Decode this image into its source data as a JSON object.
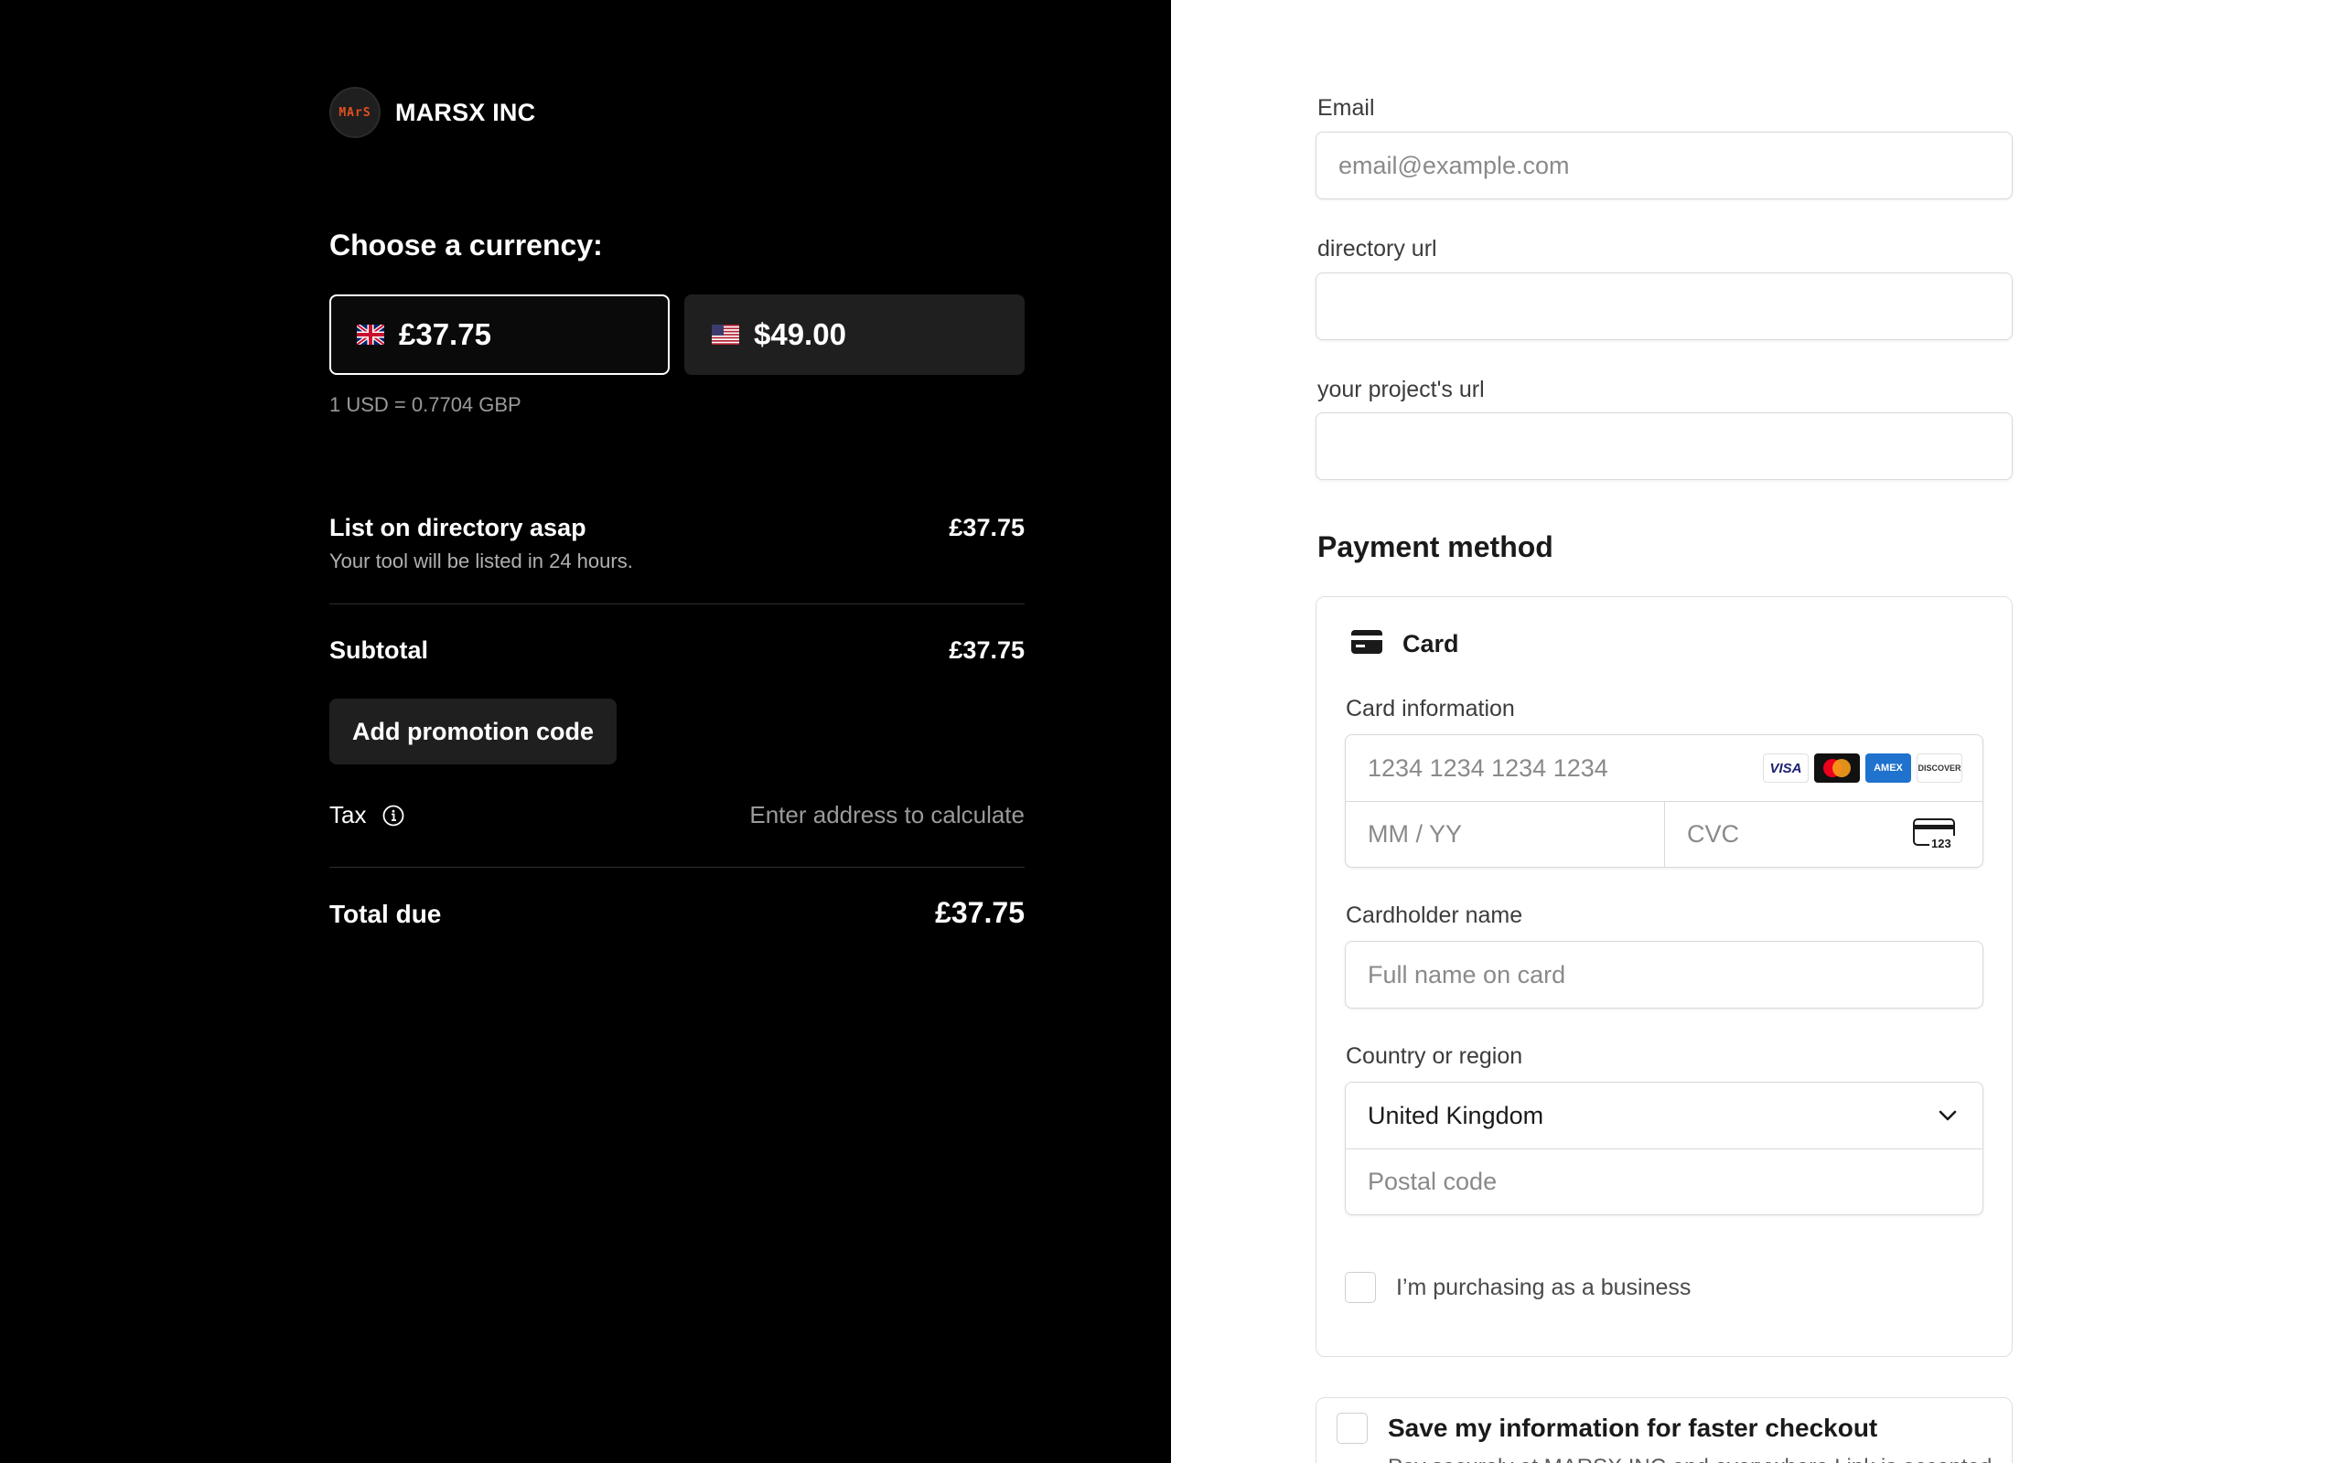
{
  "merchant": {
    "name": "MARSX INC",
    "logo_text": "MArS"
  },
  "currency": {
    "title": "Choose a currency:",
    "options": [
      {
        "code": "GBP",
        "flag": "uk-flag-icon",
        "price": "£37.75",
        "selected": true
      },
      {
        "code": "USD",
        "flag": "us-flag-icon",
        "price": "$49.00",
        "selected": false
      }
    ],
    "rate": "1 USD = 0.7704 GBP"
  },
  "order": {
    "item": {
      "name": "List on directory asap",
      "description": "Your tool will be listed in 24 hours.",
      "amount": "£37.75"
    },
    "subtotal_label": "Subtotal",
    "subtotal": "£37.75",
    "promo_label": "Add promotion code",
    "tax_label": "Tax",
    "tax_value": "Enter address to calculate",
    "total_label": "Total due",
    "total": "£37.75"
  },
  "form": {
    "email_label": "Email",
    "email_placeholder": "email@example.com",
    "directory_url_label": "directory url",
    "project_url_label": "your project's url",
    "payment_title": "Payment method",
    "card": {
      "method_label": "Card",
      "info_label": "Card information",
      "number_placeholder": "1234 1234 1234 1234",
      "expiry_placeholder": "MM / YY",
      "cvc_placeholder": "CVC",
      "brands": [
        "VISA",
        "Mastercard",
        "AMEX",
        "DISCOVER"
      ],
      "holder_label": "Cardholder name",
      "holder_placeholder": "Full name on card",
      "country_label": "Country or region",
      "country_value": "United Kingdom",
      "postal_placeholder": "Postal code",
      "business_label": "I’m purchasing as a business"
    },
    "save": {
      "label": "Save my information for faster checkout",
      "description": "Pay securely at MARSX INC and everywhere Link is accepted."
    }
  },
  "colors": {
    "left_bg": "#000000",
    "right_bg": "#ffffff",
    "button_bg": "#1f1f1f",
    "logo_accent": "#e2501f"
  }
}
